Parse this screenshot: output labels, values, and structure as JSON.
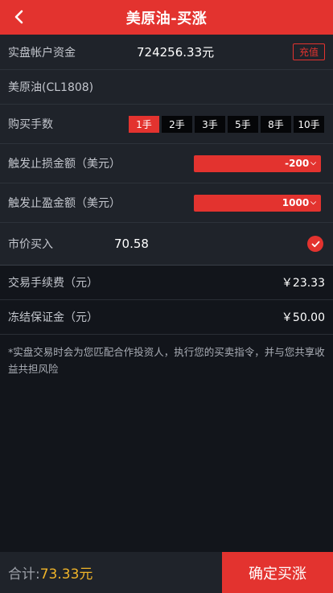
{
  "header": {
    "title": "美原油-买涨",
    "back_icon": "chevron-left-icon"
  },
  "account": {
    "label": "实盘帐户资金",
    "value": "724256.33元",
    "recharge_label": "充值"
  },
  "product": {
    "name": "美原油(CL1808)"
  },
  "lots": {
    "label": "购买手数",
    "options": [
      "1手",
      "2手",
      "3手",
      "5手",
      "8手",
      "10手"
    ],
    "selected": "1手"
  },
  "stop_loss": {
    "label": "触发止损金额（美元）",
    "value": "-200"
  },
  "take_profit": {
    "label": "触发止盈金额（美元）",
    "value": "1000"
  },
  "market_buy": {
    "label": "市价买入",
    "price": "70.58",
    "checked": true
  },
  "fee": {
    "label": "交易手续费（元）",
    "value": "￥23.33"
  },
  "margin": {
    "label": "冻结保证金（元）",
    "value": "￥50.00"
  },
  "note": "*实盘交易时会为您匹配合作投资人，执行您的买卖指令，并与您共享收益共担风险",
  "footer": {
    "total_label": "合计:",
    "total_value": "73.33元",
    "confirm_label": "确定买涨"
  },
  "colors": {
    "accent": "#e3332f",
    "total": "#f0b429",
    "background": "#12151b",
    "panel": "#1f232a"
  }
}
